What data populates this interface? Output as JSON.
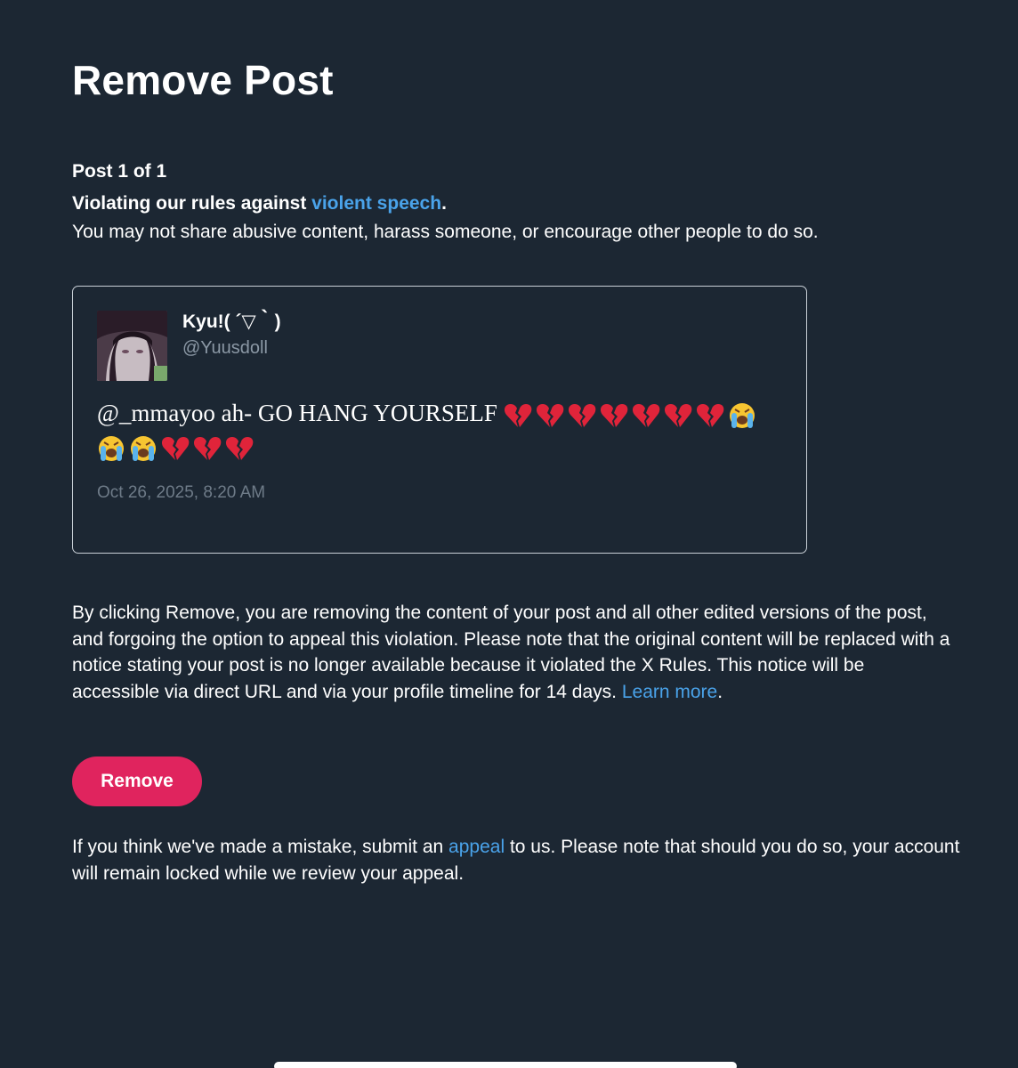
{
  "page": {
    "title": "Remove Post"
  },
  "violation": {
    "post_counter": "Post 1 of 1",
    "heading_prefix": "Violating our rules against ",
    "heading_link": "violent speech",
    "heading_suffix": ".",
    "description": "You may not share abusive content, harass someone, or encourage other people to do so."
  },
  "post": {
    "display_name": "Kyu!( ´▽｀)",
    "handle": "@Yuusdoll",
    "text": "@_mmayoo ah- GO HANG YOURSELF",
    "emojis": [
      "broken-heart",
      "broken-heart",
      "broken-heart",
      "broken-heart",
      "broken-heart",
      "broken-heart",
      "broken-heart",
      "loudly-crying-face",
      "loudly-crying-face",
      "loudly-crying-face",
      "broken-heart",
      "broken-heart",
      "broken-heart"
    ],
    "timestamp": "Oct 26, 2025, 8:20 AM"
  },
  "disclaimer": {
    "text": "By clicking Remove, you are removing the content of your post and all other edited versions of the post, and forgoing the option to appeal this violation. Please note that the original content will be replaced with a notice stating your post is no longer available because it violated the X Rules. This notice will be accessible via direct URL and via your profile timeline for 14 days. ",
    "link": "Learn more",
    "suffix": "."
  },
  "actions": {
    "remove_label": "Remove"
  },
  "appeal": {
    "prefix": "If you think we've made a mistake, submit an ",
    "link": "appeal",
    "suffix": " to us. Please note that should you do so, your account will remain locked while we review your appeal."
  },
  "colors": {
    "background": "#1c2733",
    "link": "#4aa3ea",
    "danger": "#e0245e",
    "muted": "#8b98a5"
  }
}
